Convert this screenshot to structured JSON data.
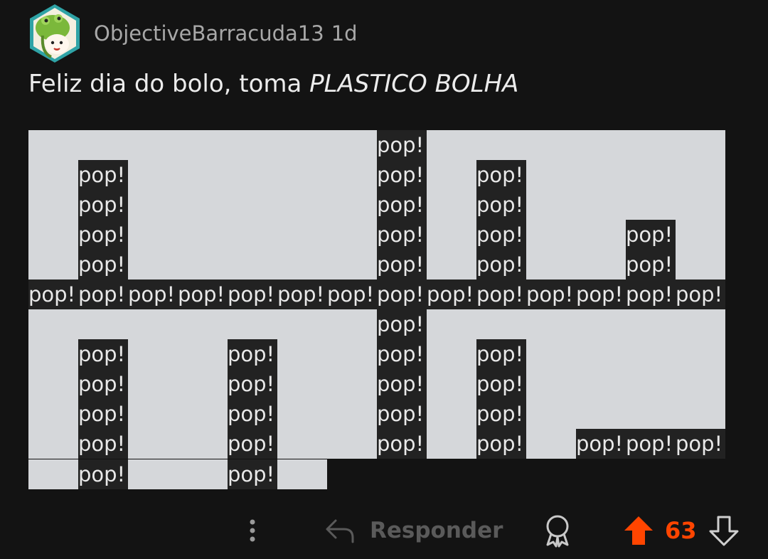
{
  "comment": {
    "username": "ObjectiveBarracuda13",
    "age": "1d",
    "text_plain": "Feliz dia do bolo, toma ",
    "text_emphasis": "PLASTICO BOLHA",
    "bubble_text": "pop!",
    "bubble_grid": [
      [
        0,
        0,
        0,
        0,
        0,
        0,
        0,
        1,
        0,
        0,
        0,
        0,
        0,
        0
      ],
      [
        0,
        1,
        0,
        0,
        0,
        0,
        0,
        1,
        0,
        1,
        0,
        0,
        0,
        0
      ],
      [
        0,
        1,
        0,
        0,
        0,
        0,
        0,
        1,
        0,
        1,
        0,
        0,
        0,
        0
      ],
      [
        0,
        1,
        0,
        0,
        0,
        0,
        0,
        1,
        0,
        1,
        0,
        0,
        1,
        0
      ],
      [
        0,
        1,
        0,
        0,
        0,
        0,
        0,
        1,
        0,
        1,
        0,
        0,
        1,
        0
      ],
      [
        1,
        1,
        1,
        1,
        1,
        1,
        1,
        1,
        1,
        1,
        1,
        1,
        1,
        1
      ],
      [
        0,
        0,
        0,
        0,
        0,
        0,
        0,
        1,
        0,
        0,
        0,
        0,
        0,
        0
      ],
      [
        0,
        1,
        0,
        0,
        1,
        0,
        0,
        1,
        0,
        1,
        0,
        0,
        0,
        0
      ],
      [
        0,
        1,
        0,
        0,
        1,
        0,
        0,
        1,
        0,
        1,
        0,
        0,
        0,
        0
      ],
      [
        0,
        1,
        0,
        0,
        1,
        0,
        0,
        1,
        0,
        1,
        0,
        0,
        0,
        0
      ],
      [
        0,
        1,
        0,
        0,
        1,
        0,
        0,
        1,
        0,
        1,
        0,
        1,
        1,
        1
      ],
      [
        0,
        1,
        0,
        0,
        1,
        0,
        -1,
        -1,
        -1,
        -1,
        -1,
        -1,
        -1,
        -1
      ]
    ]
  },
  "actions": {
    "reply_label": "Responder",
    "score": "63"
  },
  "colors": {
    "background": "#131313",
    "username": "#a8a8a8",
    "bubble_light": "#d5d7da",
    "bubble_dark": "#222222",
    "upvote": "#ff4500",
    "muted_icon": "#5a5a5a"
  },
  "icons": [
    "avatar",
    "more-icon",
    "reply-arrow-icon",
    "award-icon",
    "upvote-icon",
    "downvote-icon"
  ]
}
